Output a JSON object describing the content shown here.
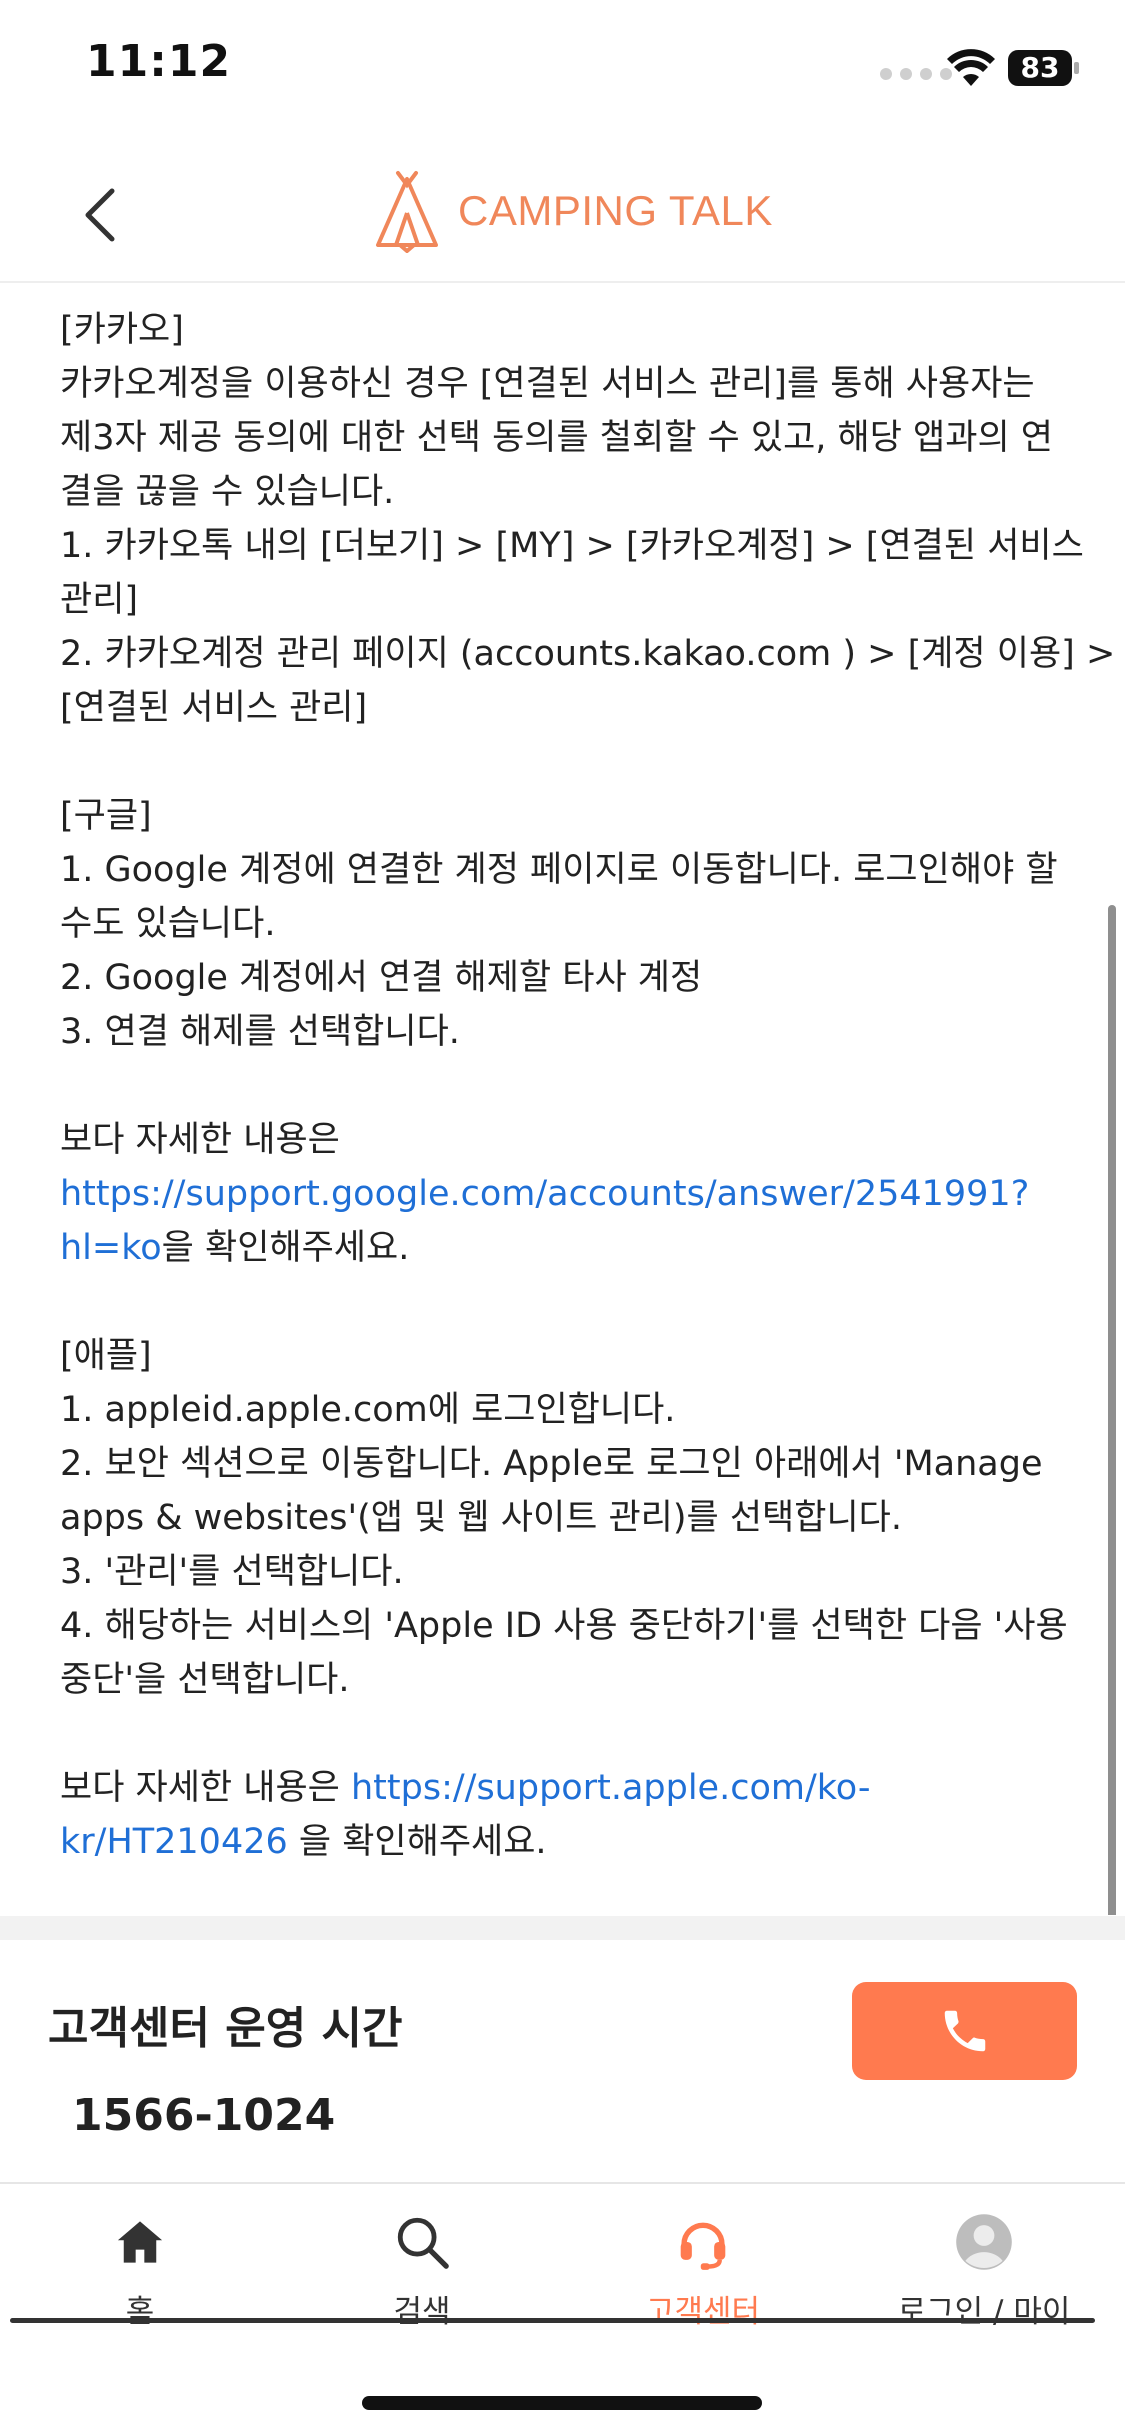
{
  "status_bar": {
    "time": "11:12",
    "battery": "83"
  },
  "header": {
    "logo_text": "CAMPING TALK"
  },
  "content": {
    "lines": [
      {
        "text": "[카카오]"
      },
      {
        "text": "카카오계정을 이용하신 경우 [연결된 서비스 관리]를 통해 사용자는"
      },
      {
        "text": "제3자 제공 동의에 대한 선택 동의를 철회할 수 있고, 해당 앱과의 연"
      },
      {
        "text": "결을 끊을 수 있습니다."
      },
      {
        "text": "1. 카카오톡 내의 [더보기] > [MY] > [카카오계정] > [연결된 서비스"
      },
      {
        "text": "관리]"
      },
      {
        "text": "2. 카카오계정 관리 페이지 (accounts.kakao.com ) > [계정 이용] >"
      },
      {
        "text": "[연결된 서비스 관리]"
      },
      {
        "text": ""
      },
      {
        "text": "[구글]"
      },
      {
        "text": "1. Google 계정에 연결한 계정 페이지로 이동합니다. 로그인해야 할"
      },
      {
        "text": "수도 있습니다."
      },
      {
        "text": "2. Google 계정에서 연결 해제할 타사 계정"
      },
      {
        "text": "3. 연결 해제를 선택합니다."
      },
      {
        "text": ""
      },
      {
        "text": "보다 자세한 내용은"
      },
      {
        "link": "https://support.google.com/accounts/answer/2541991?"
      },
      {
        "link": "hl=ko",
        "text": "을 확인해주세요."
      },
      {
        "text": ""
      },
      {
        "text": "[애플]"
      },
      {
        "text": "1. appleid.apple.com에 로그인합니다."
      },
      {
        "text": "2. 보안 섹션으로 이동합니다. Apple로 로그인 아래에서 'Manage"
      },
      {
        "text": "apps & websites'(앱 및 웹 사이트 관리)를 선택합니다."
      },
      {
        "text": "3. '관리'를 선택합니다."
      },
      {
        "text": "4. 해당하는 서비스의 'Apple ID 사용 중단하기'를 선택한 다음 '사용"
      },
      {
        "text": "중단'을 선택합니다."
      },
      {
        "text": ""
      },
      {
        "text": "보다 자세한 내용은 ",
        "link": "https://support.apple.com/ko-"
      },
      {
        "link": "kr/HT210426",
        "text": " 을 확인해주세요."
      }
    ]
  },
  "customer_center": {
    "title": "고객센터 운영 시간",
    "phone": "1566-1024"
  },
  "tab_bar": {
    "items": [
      {
        "id": "home",
        "label": "홈",
        "icon": "home-icon"
      },
      {
        "id": "search",
        "label": "검색",
        "icon": "search-icon"
      },
      {
        "id": "support",
        "label": "고객센터",
        "icon": "headset-icon",
        "active": true
      },
      {
        "id": "login",
        "label": "로그인 / 마이",
        "icon": "avatar-icon"
      }
    ]
  },
  "colors": {
    "accent": "#ff7a4f",
    "logo": "#f0875a",
    "link": "#1f6fd6"
  }
}
